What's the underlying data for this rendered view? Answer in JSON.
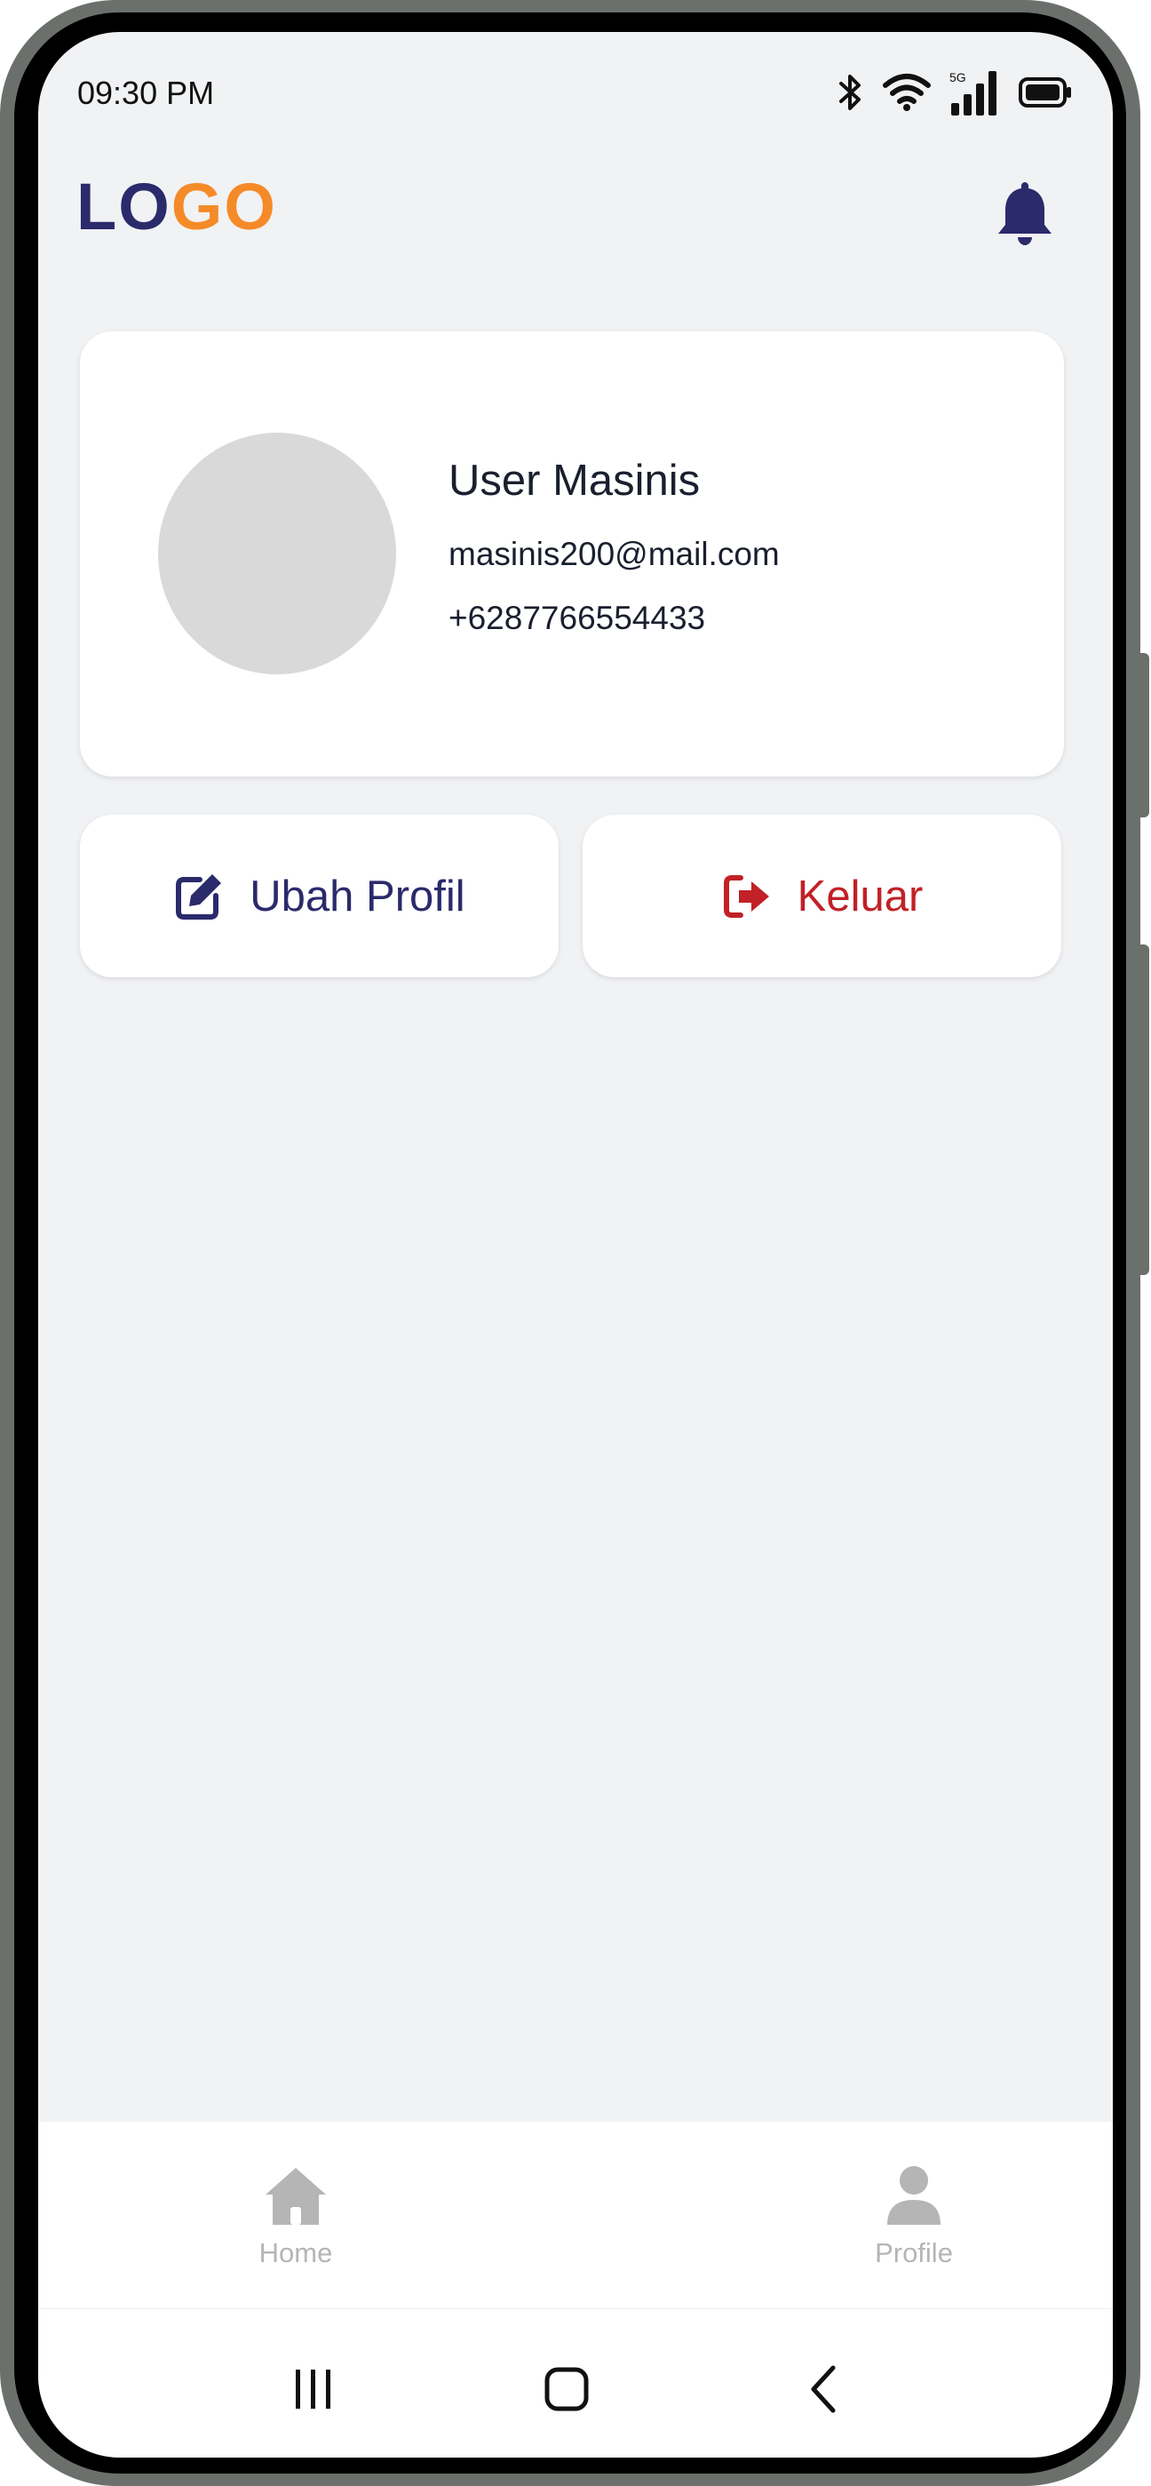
{
  "status_bar": {
    "time": "09:30 PM",
    "network": "5G",
    "icons": [
      "bluetooth-icon",
      "wifi-icon",
      "cellular-signal-icon",
      "battery-icon"
    ]
  },
  "header": {
    "logo_part1": "LO",
    "logo_part2": "GO",
    "notification_icon": "bell-icon"
  },
  "profile": {
    "name": "User Masinis",
    "email": "masinis200@mail.com",
    "phone": "+6287766554433"
  },
  "actions": {
    "edit_label": "Ubah Profil",
    "edit_icon": "edit-icon",
    "logout_label": "Keluar",
    "logout_icon": "sign-out-icon"
  },
  "bottom_nav": {
    "items": [
      {
        "label": "Home",
        "icon": "home-icon"
      },
      {
        "label": "Profile",
        "icon": "user-icon"
      }
    ]
  },
  "system_nav": {
    "buttons": [
      "recent-apps-icon",
      "home-circle-icon",
      "back-icon"
    ]
  },
  "colors": {
    "brand_primary": "#2b2a6b",
    "brand_accent": "#f58a28",
    "danger": "#c12127",
    "background": "#f1f2f4",
    "avatar_placeholder": "#d9d9d9",
    "inactive": "#b5b5b5"
  }
}
